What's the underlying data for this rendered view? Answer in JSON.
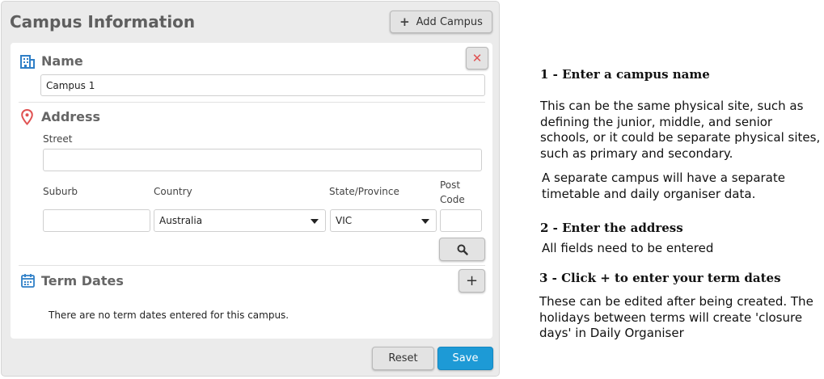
{
  "panel": {
    "title": "Campus Information",
    "add_campus_label": "Add Campus",
    "add_campus_icon": "plus-icon"
  },
  "name_section": {
    "title": "Name",
    "icon": "building-icon",
    "value": "Campus 1",
    "close_icon": "close-icon"
  },
  "address_section": {
    "title": "Address",
    "icon": "location-pin-icon",
    "street_label": "Street",
    "street_value": "",
    "suburb_label": "Suburb",
    "suburb_value": "",
    "country_label": "Country",
    "country_value": "Australia",
    "state_label": "State/Province",
    "state_value": "VIC",
    "postcode_label": "Post Code",
    "postcode_value": "",
    "search_icon": "search-icon"
  },
  "term_dates_section": {
    "title": "Term Dates",
    "icon": "calendar-icon",
    "add_label": "+",
    "empty_message": "There are no term dates entered for this campus."
  },
  "footer": {
    "reset_label": "Reset",
    "save_label": "Save"
  },
  "colors": {
    "accent": "#1d9ad6",
    "icon_blue": "#2f7fc7",
    "icon_red": "#e05252"
  },
  "help": {
    "step1_title": "1 - Enter a campus name",
    "step1_text_a": "This can be the same physical site, such as defining the junior, middle, and senior schools, or it could be separate physical sites, such as primary and secondary.",
    "step1_text_b": "A separate campus will have a separate timetable and daily organiser data.",
    "step2_title": "2 - Enter the address",
    "step2_text": "All fields need to be entered",
    "step3_title": "3 - Click + to enter your term dates",
    "step3_text": "These can be edited after being created. The holidays between terms will create 'closure days' in Daily Organiser"
  }
}
